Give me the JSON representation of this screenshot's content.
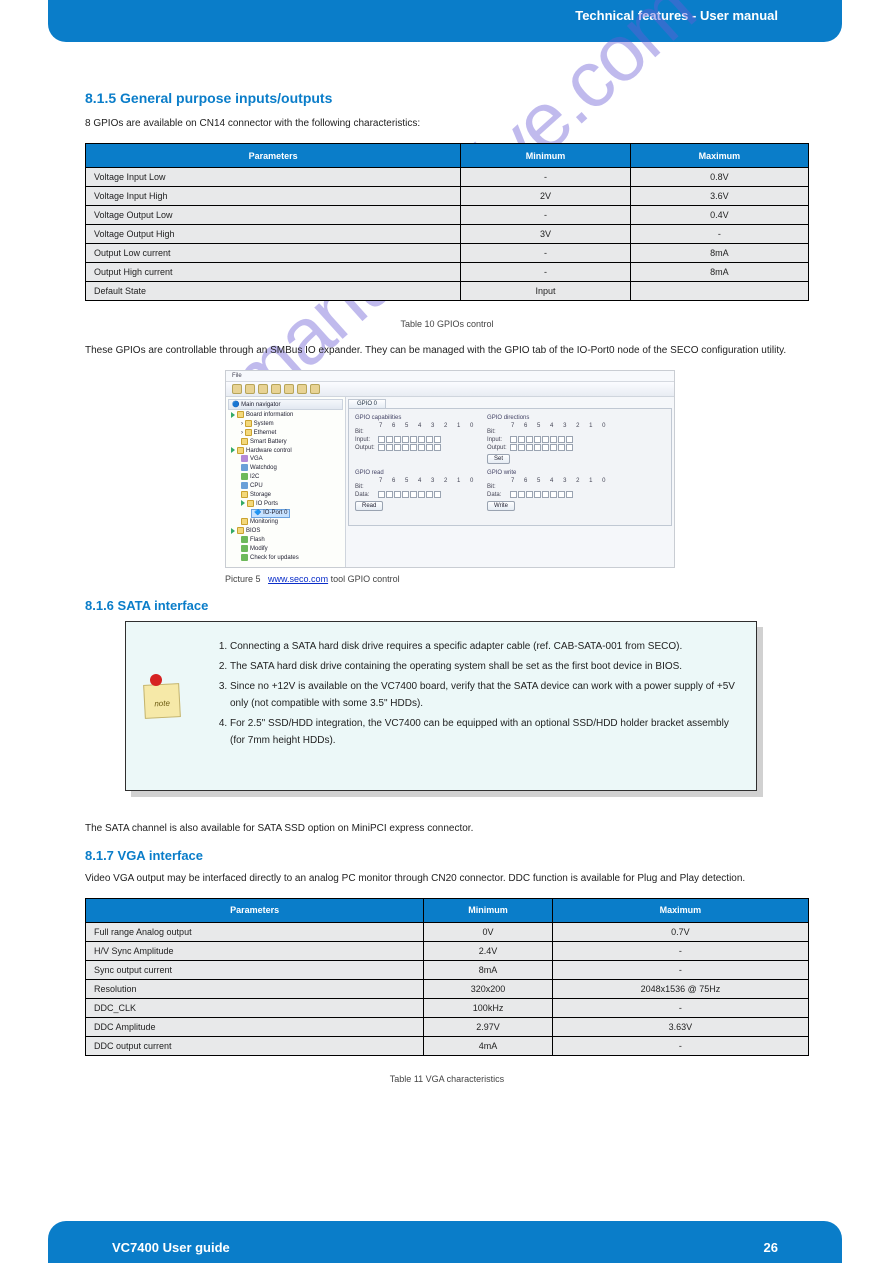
{
  "banner": {
    "top_right": "Technical features - User manual",
    "bottom_left": "VC7400 User guide",
    "bottom_right": "26"
  },
  "section_gpio": {
    "title": "8.1.5 General purpose inputs/outputs",
    "intro": "8 GPIOs are available on CN14 connector with the following characteristics:",
    "table_headers": [
      "Parameters",
      "Minimum",
      "Maximum"
    ],
    "rows": [
      [
        "Voltage Input Low",
        "-",
        "0.8V"
      ],
      [
        "Voltage Input High",
        "2V",
        "3.6V"
      ],
      [
        "Voltage Output Low",
        "-",
        "0.4V"
      ],
      [
        "Voltage Output High",
        "3V",
        "-"
      ],
      [
        "Output Low current",
        "-",
        "8mA"
      ],
      [
        "Output High current",
        "-",
        "8mA"
      ],
      [
        "Default State",
        "Input",
        ""
      ]
    ],
    "table_caption": "Table 10   GPIOs control",
    "under_text": "These GPIOs are controllable through an SMBus IO expander. They can be managed with the GPIO tab of the IO-Port0 node of the SECO configuration utility.",
    "caption_credit_label": "Picture 5",
    "caption_credit": "www.seco.com",
    "caption_tail": " tool GPIO control"
  },
  "appshot": {
    "menu_label": "File",
    "nav_title": "Main navigator",
    "tree": {
      "root": "Board information",
      "sys": "System",
      "eth": "Ethernet",
      "bat": "Smart Battery",
      "hw": "Hardware control",
      "vga": "VGA",
      "wdg": "Watchdog",
      "i2c": "I2C",
      "cpu": "CPU",
      "sto": "Storage",
      "iop": "IO Ports",
      "ioport0": "IO-Port 0",
      "mon": "Monitoring",
      "bios": "BIOS",
      "flash": "Flash",
      "modify": "Modify",
      "check": "Check for updates"
    },
    "tab": "GPIO 0",
    "groups": {
      "caps": "GPIO capabilities",
      "dir": "GPIO directions",
      "read": "GPIO read",
      "write": "GPIO write"
    },
    "row_labels": {
      "bit": "Bit:",
      "input": "Input:",
      "output": "Output:",
      "data": "Data:"
    },
    "bit_nums": "7 6 5 4 3 2 1 0",
    "btns": {
      "set": "Set",
      "read": "Read",
      "write": "Write"
    }
  },
  "section_sata": {
    "title": "8.1.6 SATA interface",
    "note_items": [
      "Connecting a SATA hard disk drive requires a specific adapter cable (ref. CAB-SATA-001 from SECO).",
      "The SATA hard disk drive containing the operating system shall be set as the first boot device in BIOS.",
      "Since no +12V is available on the VC7400 board, verify that the SATA device can work with a power supply of +5V only (not compatible with some 3.5\" HDDs).",
      "For 2.5\" SSD/HDD integration, the VC7400 can be equipped with an optional SSD/HDD holder bracket assembly (for 7mm height HDDs)."
    ],
    "after_note": "The SATA channel is also available for SATA SSD option on MiniPCI express connector.",
    "sub_title": "8.1.7 VGA interface",
    "sub_text": "Video VGA output may be interfaced directly to an analog PC monitor through CN20 connector. DDC function is available for Plug and Play detection.",
    "table_headers": [
      "Parameters",
      "Minimum",
      "Maximum"
    ],
    "rows": [
      [
        "Full range Analog output",
        "0V",
        "0.7V"
      ],
      [
        "H/V Sync Amplitude",
        "2.4V",
        "-"
      ],
      [
        "Sync output current",
        "8mA",
        "-"
      ],
      [
        "Resolution",
        "320x200",
        "2048x1536 @ 75Hz"
      ],
      [
        "DDC_CLK",
        "100kHz",
        "-"
      ],
      [
        "DDC Amplitude",
        "2.97V",
        "3.63V"
      ],
      [
        "DDC output current",
        "4mA",
        "-"
      ]
    ],
    "table_caption": "Table 11   VGA characteristics"
  },
  "watermark": "manualshive.com"
}
